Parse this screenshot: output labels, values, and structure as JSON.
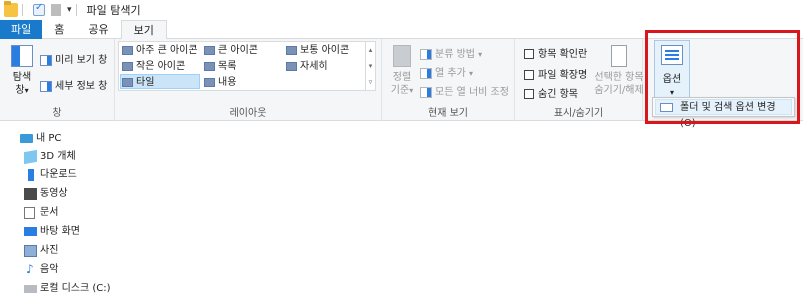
{
  "window": {
    "title": "파일 탐색기",
    "quick_access_dropdown": "▾"
  },
  "tabs": [
    {
      "label": "파일"
    },
    {
      "label": "홈"
    },
    {
      "label": "공유"
    },
    {
      "label": "보기"
    }
  ],
  "ribbon": {
    "pane_group": {
      "label": "창",
      "nav_pane": "탐색",
      "nav_pane_line2": "창",
      "nav_pane_arrow": "▾",
      "preview_pane": "미리 보기 창",
      "details_pane": "세부 정보 창"
    },
    "layout_group": {
      "label": "레이아웃",
      "items": [
        {
          "label": "아주 큰 아이콘"
        },
        {
          "label": "큰 아이콘"
        },
        {
          "label": "보통 아이콘"
        },
        {
          "label": "작은 아이콘"
        },
        {
          "label": "목록"
        },
        {
          "label": "자세히"
        },
        {
          "label": "타일",
          "selected": true
        },
        {
          "label": "내용"
        }
      ],
      "scroll_up": "▴",
      "scroll_down": "▾",
      "scroll_more": "▿"
    },
    "current_view_group": {
      "label": "현재 보기",
      "sort_by": "정렬",
      "sort_by_line2": "기준",
      "sort_arrow": "▾",
      "group_by": "분류 방법",
      "group_arrow": "▾",
      "add_columns": "열 추가",
      "add_arrow": "▾",
      "fit_columns": "모든 열 너비 조정"
    },
    "show_hide_group": {
      "label": "표시/숨기기",
      "item_checkboxes": "항목 확인란",
      "file_extensions": "파일 확장명",
      "hidden_items": "숨긴 항목",
      "hide_selected": "선택한 항목",
      "hide_selected_line2": "숨기기/해제"
    },
    "options": {
      "label": "옵션",
      "arrow": "▾",
      "dropdown_item": "폴더 및 검색 옵션 변경(O)"
    }
  },
  "nav_pane": {
    "items": [
      {
        "label": "내 PC",
        "icon": "pc-icon"
      },
      {
        "label": "3D 개체",
        "icon": "3d-objects-icon"
      },
      {
        "label": "다운로드",
        "icon": "download-icon"
      },
      {
        "label": "동영상",
        "icon": "video-icon"
      },
      {
        "label": "문서",
        "icon": "document-icon"
      },
      {
        "label": "바탕 화면",
        "icon": "desktop-icon"
      },
      {
        "label": "사진",
        "icon": "pictures-icon"
      },
      {
        "label": "음악",
        "icon": "music-icon"
      },
      {
        "label": "로컬 디스크 (C:)",
        "icon": "local-disk-icon"
      }
    ]
  },
  "colors": {
    "file_tab": "#1979ca",
    "highlight_box": "#d9161b",
    "selected_item": "#cce4f7"
  }
}
